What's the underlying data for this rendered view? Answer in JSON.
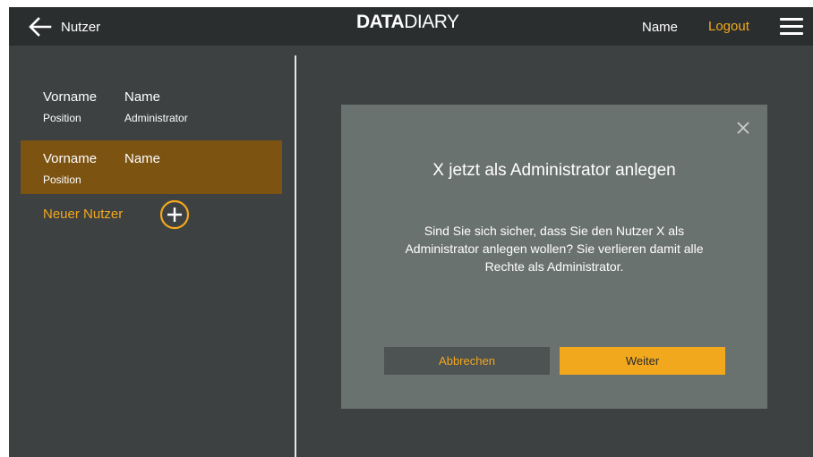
{
  "header": {
    "back_label": "Nutzer",
    "brand_bold": "DATA",
    "brand_light": "DIARY",
    "user_name": "Name",
    "logout_label": "Logout"
  },
  "users": [
    {
      "first_name": "Vorname",
      "last_name": "Name",
      "position": "Position",
      "role": "Administrator",
      "selected": false
    },
    {
      "first_name": "Vorname",
      "last_name": "Name",
      "position": "Position",
      "role": "",
      "selected": true
    }
  ],
  "new_user_label": "Neuer Nutzer",
  "modal": {
    "title": "X  jetzt als Administrator anlegen",
    "body": "Sind Sie sich sicher, dass Sie den Nutzer  X  als Administrator anlegen wollen? Sie verlieren damit alle Rechte als Administrator.",
    "cancel_label": "Abbrechen",
    "confirm_label": "Weiter"
  },
  "colors": {
    "accent": "#f2a81d",
    "header_bg": "#2b2e2f",
    "app_bg": "#3d4142",
    "selected_bg": "#7c5311",
    "modal_bg": "#6a726f"
  },
  "icons": {
    "back": "arrow-left-icon",
    "menu": "hamburger-menu-icon",
    "add": "plus-circle-icon",
    "close": "close-icon"
  }
}
